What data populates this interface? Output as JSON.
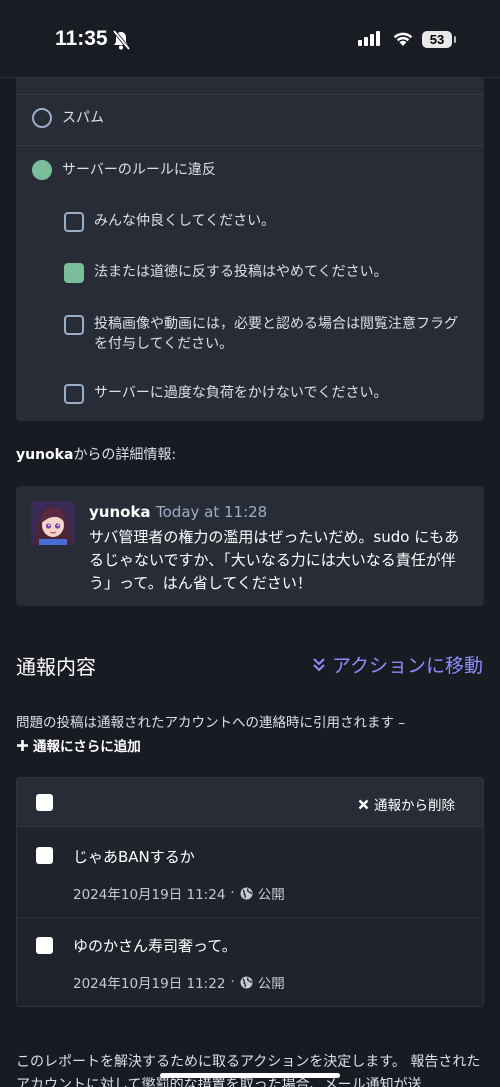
{
  "status_bar": {
    "time": "11:35",
    "battery": "53"
  },
  "rules": {
    "option_spam": "スパム",
    "option_violation": "サーバーのルールに違反",
    "items": [
      {
        "label": "みんな仲良くしてください。",
        "checked": false
      },
      {
        "label": "法または道徳に反する投稿はやめてください。",
        "checked": true
      },
      {
        "label": "投稿画像や動画には，必要と認める場合は閲覧注意フラグを付与してください。",
        "checked": false
      },
      {
        "label": "サーバーに過度な負荷をかけないでください。",
        "checked": false
      }
    ]
  },
  "details": {
    "username": "yunoka",
    "label_suffix": "からの詳細情報:"
  },
  "comment": {
    "author": "yunoka",
    "time": "Today at 11:28",
    "text": "サバ管理者の権力の濫用はぜったいだめ。sudo にもあるじゃないですか、「大いなる力には大いなる責任が伴う」って。はん省してください！"
  },
  "report_content": {
    "title": "通報内容",
    "action_link": "アクションに移動",
    "note": "問題の投稿は通報されたアカウントへの連絡時に引用されます –",
    "add_link": "通報にさらに追加",
    "remove_button": "通報から削除",
    "posts": [
      {
        "text": "じゃあBANするか",
        "date": "2024年10月19日 11:24",
        "visibility": "公開"
      },
      {
        "text": "ゆのかさん寿司奢って。",
        "date": "2024年10月19日 11:22",
        "visibility": "公開"
      }
    ]
  },
  "footer_text": "このレポートを解決するために取るアクションを決定します。 報告されたアカウントに対して懲罰的な措置を取った場合、メール通知が送",
  "colors": {
    "background": "#191b22",
    "panel": "#282c37",
    "accent_green": "#79bd9a",
    "link_purple": "#8c8dff"
  }
}
